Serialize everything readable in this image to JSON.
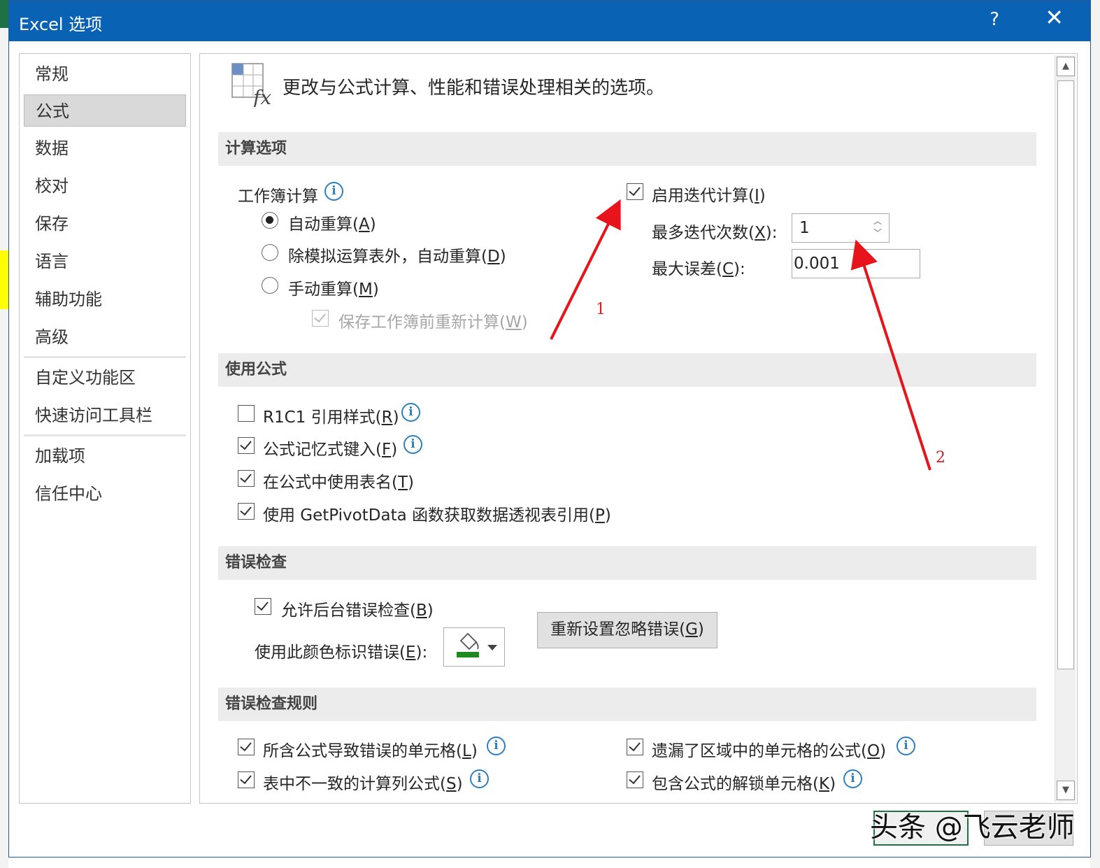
{
  "window": {
    "title": "Excel 选项",
    "help": "?",
    "close": "✕"
  },
  "nav": {
    "items": [
      {
        "label": "常规"
      },
      {
        "label": "公式"
      },
      {
        "label": "数据"
      },
      {
        "label": "校对"
      },
      {
        "label": "保存"
      },
      {
        "label": "语言"
      },
      {
        "label": "辅助功能"
      },
      {
        "label": "高级"
      },
      {
        "label": "自定义功能区"
      },
      {
        "label": "快速访问工具栏"
      },
      {
        "label": "加载项"
      },
      {
        "label": "信任中心"
      }
    ],
    "selected": "公式"
  },
  "header": {
    "text": "更改与公式计算、性能和错误处理相关的选项。",
    "icon": "formula-fx-icon"
  },
  "calc": {
    "section": "计算选项",
    "workbook_label": "工作簿计算",
    "auto": {
      "text": "自动重算(",
      "key": "A",
      "end": ")",
      "selected": true
    },
    "auto_except": {
      "text": "除模拟运算表外，自动重算(",
      "key": "D",
      "end": ")",
      "selected": false
    },
    "manual": {
      "text": "手动重算(",
      "key": "M",
      "end": ")",
      "selected": false
    },
    "recalc_before_save": {
      "text": "保存工作簿前重新计算(",
      "key": "W",
      "end": ")",
      "checked": true,
      "disabled": true
    },
    "iterative": {
      "text": "启用迭代计算(",
      "key": "I",
      "end": ")",
      "checked": true
    },
    "max_iter": {
      "text": "最多迭代次数(",
      "key": "X",
      "end": "):",
      "value": "1"
    },
    "max_change": {
      "text": "最大误差(",
      "key": "C",
      "end": "):",
      "value": "0.001"
    }
  },
  "formulas": {
    "section": "使用公式",
    "r1c1": {
      "text": "R1C1 引用样式(",
      "key": "R",
      "end": ")",
      "checked": false
    },
    "autocomplete": {
      "text": "公式记忆式键入(",
      "key": "F",
      "end": ")",
      "checked": true
    },
    "table_names": {
      "text": "在公式中使用表名(",
      "key": "T",
      "end": ")",
      "checked": true
    },
    "getpivot": {
      "text": "使用 GetPivotData 函数获取数据透视表引用(",
      "key": "P",
      "end": ")",
      "checked": true
    }
  },
  "errors": {
    "section": "错误检查",
    "background": {
      "text": "允许后台错误检查(",
      "key": "B",
      "end": ")",
      "checked": true
    },
    "color_label": {
      "text": "使用此颜色标识错误(",
      "key": "E",
      "end": "):"
    },
    "color_value": "#1e8a1e",
    "reset_button": {
      "text": "重新设置忽略错误(",
      "key": "G",
      "end": ")"
    }
  },
  "rules": {
    "section": "错误检查规则",
    "r1": {
      "text": "所含公式导致错误的单元格(",
      "key": "L",
      "end": ")",
      "checked": true
    },
    "r2": {
      "text": "遗漏了区域中的单元格的公式(",
      "key": "O",
      "end": ")",
      "checked": true
    },
    "r3": {
      "text": "表中不一致的计算列公式(",
      "key": "S",
      "end": ")",
      "checked": true
    },
    "r4": {
      "text": "包含公式的解锁单元格(",
      "key": "K",
      "end": ")",
      "checked": true
    }
  },
  "annotations": {
    "a1": "1",
    "a2": "2",
    "color": "#e8141b"
  },
  "watermark": "头条 @飞云老师",
  "colors": {
    "titlebar": "#0a62b4",
    "info": "#2f7fbf"
  }
}
